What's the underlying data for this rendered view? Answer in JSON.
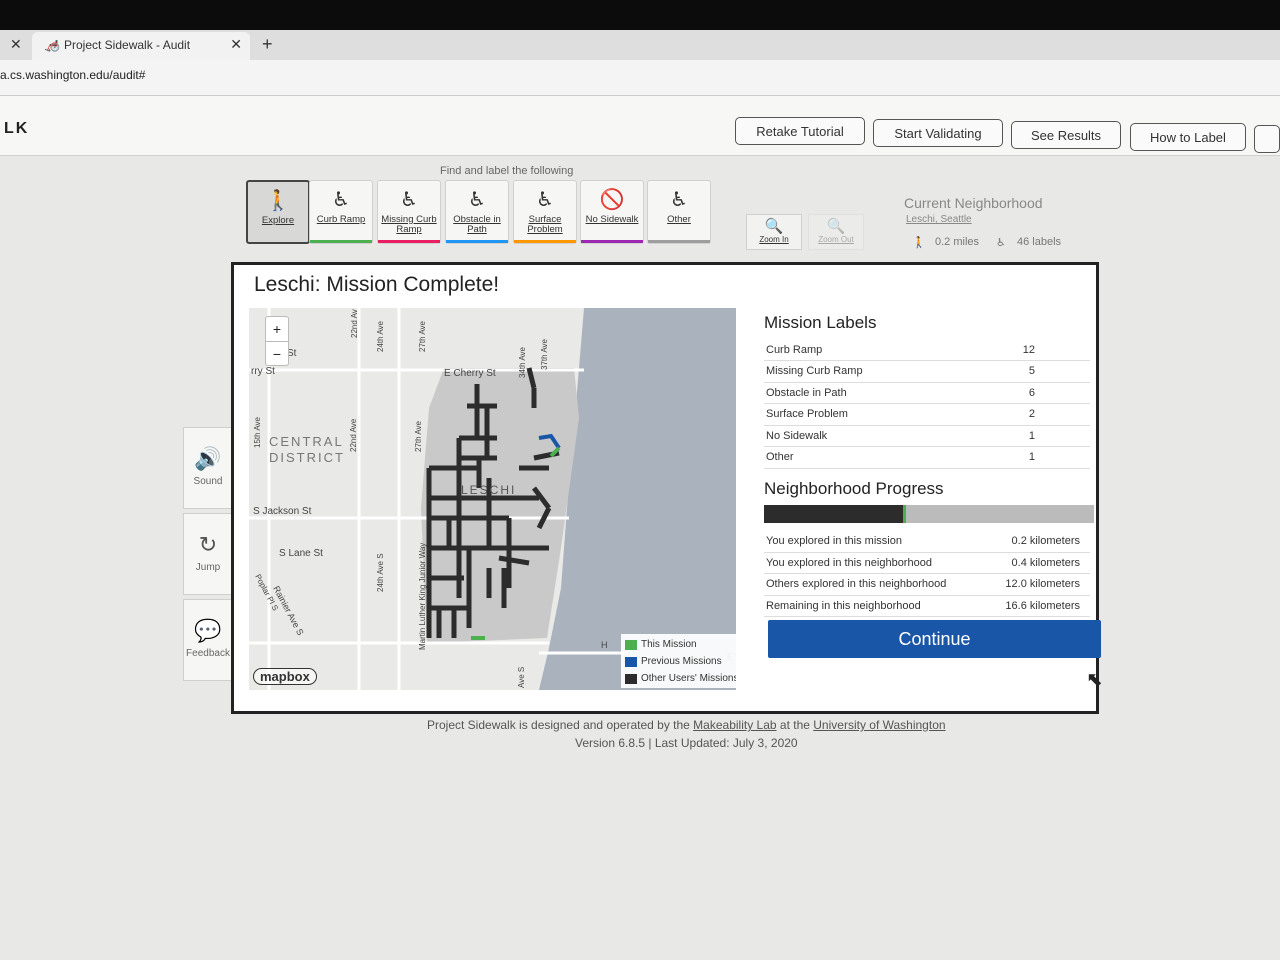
{
  "browser": {
    "prev_tab_close": "✕",
    "tab_title": "Project Sidewalk - Audit",
    "tab_close": "✕",
    "new_tab": "+",
    "url": "a.cs.washington.edu/audit#"
  },
  "header": {
    "logo": "LK",
    "buttons": [
      "Retake Tutorial",
      "Start Validating",
      "See Results",
      "How to Label"
    ]
  },
  "toolbar": {
    "instruction": "Find and label the following",
    "tools": [
      {
        "label": "Explore",
        "icon": "walking-person-icon",
        "glyph": "🚶",
        "color": ""
      },
      {
        "label": "Curb Ramp",
        "icon": "curb-ramp-icon",
        "glyph": "♿",
        "color": "#4caf50"
      },
      {
        "label": "Missing Curb Ramp",
        "icon": "missing-curb-ramp-icon",
        "glyph": "♿",
        "color": "#e91e63"
      },
      {
        "label": "Obstacle in Path",
        "icon": "obstacle-icon",
        "glyph": "♿",
        "color": "#2196f3"
      },
      {
        "label": "Surface Problem",
        "icon": "surface-problem-icon",
        "glyph": "♿",
        "color": "#ff9800"
      },
      {
        "label": "No Sidewalk",
        "icon": "no-sidewalk-icon",
        "glyph": "🚫",
        "color": "#9c27b0"
      },
      {
        "label": "Other",
        "icon": "other-icon",
        "glyph": "♿",
        "color": "#9e9e9e"
      }
    ],
    "zoom_in": "Zoom In",
    "zoom_out": "Zoom Out"
  },
  "neighborhood": {
    "title": "Current Neighborhood",
    "name": "Leschi, Seattle",
    "distance": "0.2 miles",
    "labels": "46 labels"
  },
  "side_buttons": [
    "Sound",
    "Jump",
    "Feedback"
  ],
  "modal": {
    "title": "Leschi: Mission Complete!",
    "mission_labels_title": "Mission Labels",
    "mission_labels": [
      {
        "label": "Curb Ramp",
        "value": "12"
      },
      {
        "label": "Missing Curb Ramp",
        "value": "5"
      },
      {
        "label": "Obstacle in Path",
        "value": "6"
      },
      {
        "label": "Surface Problem",
        "value": "2"
      },
      {
        "label": "No Sidewalk",
        "value": "1"
      },
      {
        "label": "Other",
        "value": "1"
      }
    ],
    "progress_title": "Neighborhood Progress",
    "progress": {
      "explored_fraction": 0.42,
      "this_mission_fraction": 0.01
    },
    "progress_rows": [
      {
        "label": "You explored in this mission",
        "value": "0.2 kilometers"
      },
      {
        "label": "You explored in this neighborhood",
        "value": "0.4 kilometers"
      },
      {
        "label": "Others explored in this neighborhood",
        "value": "12.0 kilometers"
      },
      {
        "label": "Remaining in this neighborhood",
        "value": "16.6 kilometers"
      }
    ],
    "continue": "Continue"
  },
  "map": {
    "zoom_plus": "+",
    "zoom_minus": "−",
    "labels": {
      "cherry": "E Cherry St",
      "rry": "rry St",
      "st": "St",
      "central": "CENTRAL",
      "district": "DISTRICT",
      "jackson": "S Jackson St",
      "lane": "S Lane St",
      "leschi": "LESCHI",
      "a22": "22nd Av",
      "a24": "24th Ave",
      "a27": "27th Ave",
      "a15": "15th Ave",
      "a22b": "22nd Ave",
      "a27b": "27th Ave",
      "a24s": "24th Ave S",
      "mlk": "Martin Luther King Junior Way",
      "a34": "34th Ave",
      "a37": "37th Ave",
      "rainier": "Rainier Ave S",
      "poplar": "Poplar Pl S",
      "aves": "Ave S",
      "e": "E",
      "h": "H"
    },
    "legend": [
      {
        "label": "This Mission",
        "color": "#4caf50"
      },
      {
        "label": "Previous Missions",
        "color": "#1a56a8"
      },
      {
        "label": "Other Users' Missions",
        "color": "#2c2c2c"
      }
    ],
    "attribution": "mapbox",
    "colors": {
      "water": "#aab3bd",
      "land": "#e9e9e7",
      "region": "#c9c9c9",
      "route": "#2c2c2c"
    }
  },
  "footer": {
    "text_1": "Project Sidewalk is designed and operated by the ",
    "link_1": "Makeability Lab",
    "text_2": " at the ",
    "link_2": "University of Washington",
    "version": "Version 6.8.5 | Last Updated: July 3, 2020"
  }
}
